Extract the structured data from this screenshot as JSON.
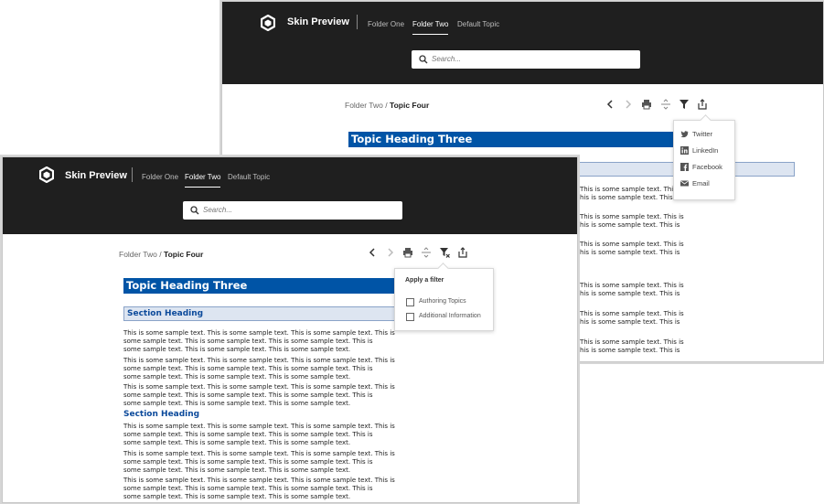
{
  "brand": "Skin Preview",
  "nav": [
    "Folder One",
    "Folder Two",
    "Default Topic"
  ],
  "search_placeholder": "Search...",
  "breadcrumb": {
    "parent": "Folder Two",
    "sep": "/",
    "current": "Topic Four"
  },
  "topic_heading": "Topic Heading Three",
  "section_heading": "Section Heading",
  "sample_line_a": "This is some sample text. This is some sample text. This is some sample text. This is",
  "sample_line_b": "some sample text. This is some sample text. This is some sample text. This is",
  "sample_line_c": "some sample text. This is some sample text. This is some sample text.",
  "share_menu": [
    "Twitter",
    "LinkedIn",
    "Facebook",
    "Email"
  ],
  "filter": {
    "title": "Apply a filter",
    "options": [
      "Authoring Topics",
      "Additional Information"
    ]
  },
  "back_partial": {
    "line_a": "This is some sample text. This is",
    "line_b": "ome sample text. This is some sample text. This is",
    "share_heading_fragment": "his is some sample text. This is"
  }
}
